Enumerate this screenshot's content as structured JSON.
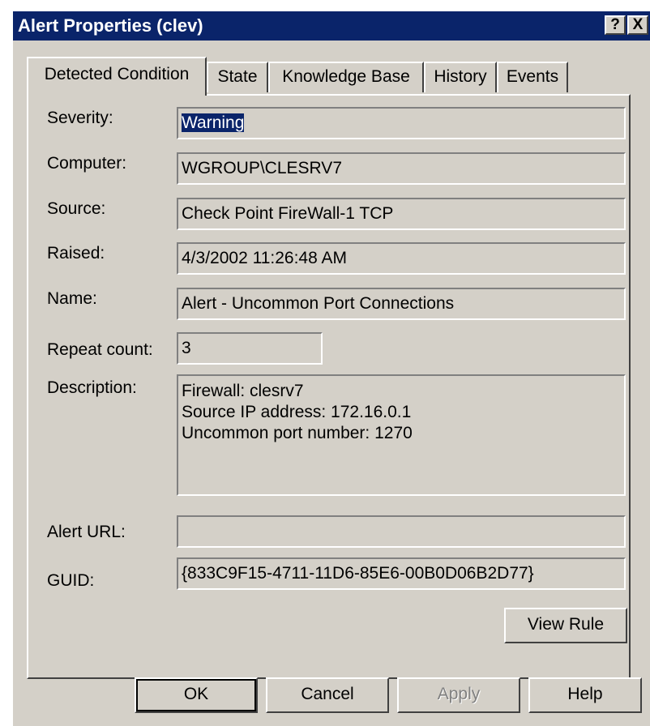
{
  "window": {
    "title": "Alert Properties (clev)",
    "help_label": "?",
    "close_label": "X"
  },
  "tabs": [
    {
      "label": "Detected Condition",
      "active": true
    },
    {
      "label": "State"
    },
    {
      "label": "Knowledge Base"
    },
    {
      "label": "History"
    },
    {
      "label": "Events"
    }
  ],
  "fields": {
    "severity": {
      "label": "Severity:",
      "value": "Warning"
    },
    "computer": {
      "label": "Computer:",
      "value": "WGROUP\\CLESRV7"
    },
    "source": {
      "label": "Source:",
      "value": "Check Point FireWall-1 TCP"
    },
    "raised": {
      "label": "Raised:",
      "value": "4/3/2002 11:26:48 AM"
    },
    "name": {
      "label": "Name:",
      "value": "Alert - Uncommon Port Connections"
    },
    "repeat_count": {
      "label": "Repeat count:",
      "value": "3"
    },
    "description": {
      "label": "Description:",
      "lines": [
        "Firewall: clesrv7",
        "Source IP address: 172.16.0.1",
        "Uncommon port number: 1270"
      ]
    },
    "alert_url": {
      "label": "Alert URL:",
      "value": ""
    },
    "guid": {
      "label": "GUID:",
      "value": "{833C9F15-4711-11D6-85E6-00B0D06B2D77}"
    }
  },
  "buttons": {
    "view_rule": "View Rule",
    "ok": "OK",
    "cancel": "Cancel",
    "apply": "Apply",
    "help": "Help"
  }
}
